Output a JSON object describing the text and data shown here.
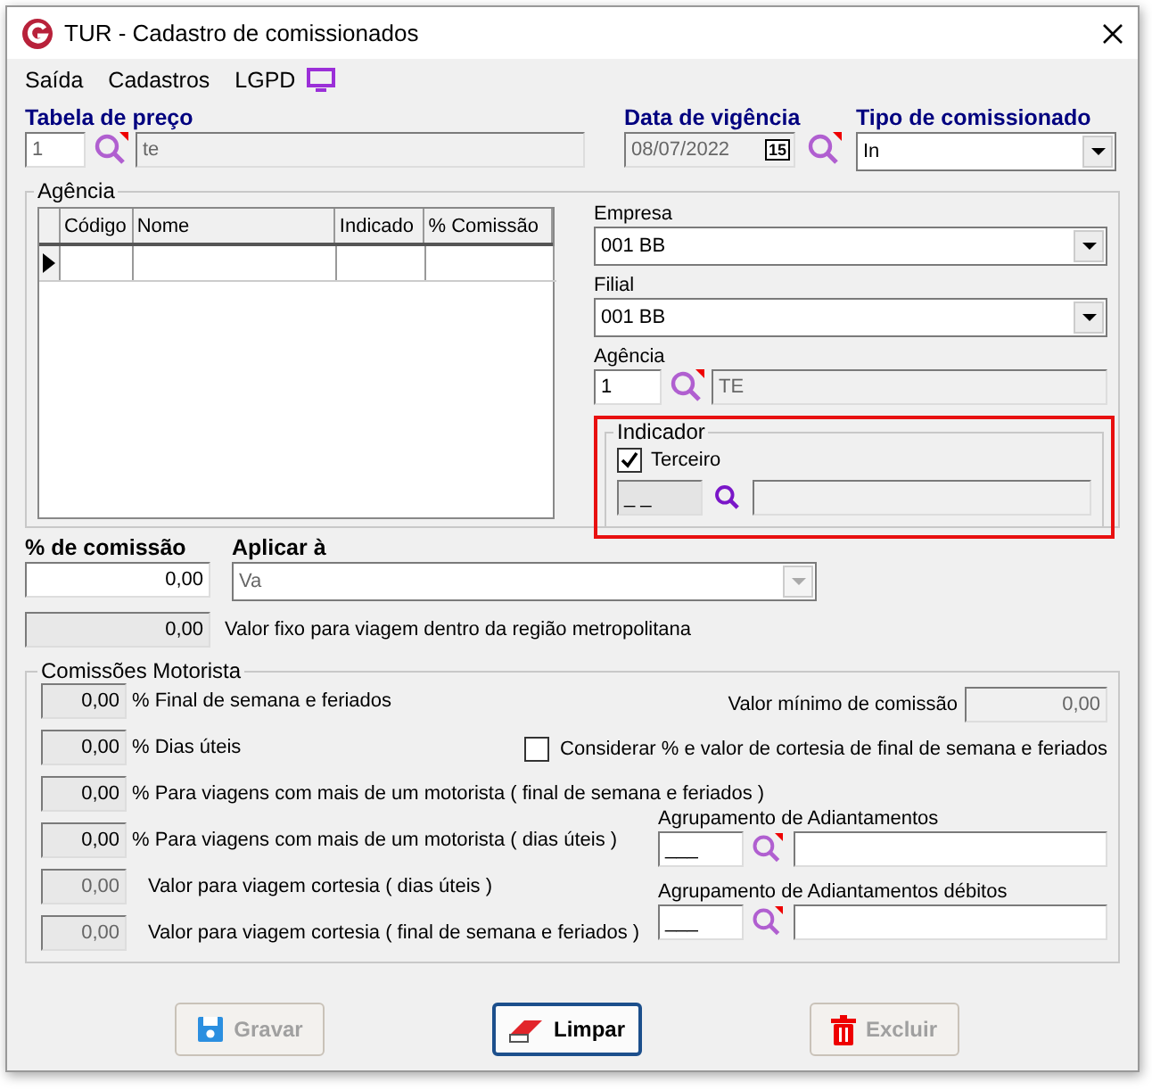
{
  "window": {
    "title": "TUR - Cadastro de comissionados"
  },
  "menu": [
    {
      "label": "Saída"
    },
    {
      "label": "Cadastros"
    },
    {
      "label": "LGPD"
    }
  ],
  "header": {
    "tabela": {
      "label": "Tabela de preço",
      "code": "1",
      "name": "te"
    },
    "data": {
      "label": "Data de vigência",
      "value": "08/07/2022",
      "calendar": "15"
    },
    "tipo": {
      "label": "Tipo de comissionado",
      "value": "In"
    }
  },
  "agencia": {
    "title": "Agência",
    "columns": [
      "Código",
      "Nome",
      "Indicado",
      "% Comissão"
    ],
    "empresa": {
      "label": "Empresa",
      "value": "001 BB"
    },
    "filial": {
      "label": "Filial",
      "value": "001 BB"
    },
    "agencia": {
      "label": "Agência",
      "code": "1",
      "name": "TE"
    },
    "indicador": {
      "title": "Indicador",
      "highlighted": true,
      "terceiro": {
        "label": "Terceiro",
        "checked": true
      },
      "code": "_ _"
    }
  },
  "comissao": {
    "label": "% de comissão",
    "value": "0,00"
  },
  "aplicar": {
    "label": "Aplicar à",
    "value": "Va",
    "disabled": true
  },
  "valor_fixo": {
    "value": "0,00",
    "label": "Valor fixo para viagem dentro da região metropolitana"
  },
  "motorista": {
    "title": "Comissões Motorista",
    "rows": [
      {
        "value": "0,00",
        "label": "% Final de semana e feriados",
        "disabled": false
      },
      {
        "value": "0,00",
        "label": "% Dias úteis",
        "disabled": false
      },
      {
        "value": "0,00",
        "label": "% Para viagens com mais de um motorista ( final de semana e feriados )",
        "disabled": false
      },
      {
        "value": "0,00",
        "label": "% Para viagens com mais de um motorista ( dias úteis )",
        "disabled": false
      },
      {
        "value": "0,00",
        "label": "Valor para viagem cortesia ( dias úteis )",
        "disabled": true
      },
      {
        "value": "0,00",
        "label": "Valor para viagem cortesia ( final de semana e feriados )",
        "disabled": true
      }
    ],
    "valor_minimo": {
      "label": "Valor mínimo de comissão",
      "value": "0,00"
    },
    "considerar": {
      "label": "Considerar % e valor de cortesia de final de semana e feriados",
      "checked": false
    },
    "agrupamentos": [
      {
        "label": "Agrupamento de Adiantamentos",
        "code": "___"
      },
      {
        "label": "Agrupamento de Adiantamentos débitos",
        "code": "___"
      }
    ]
  },
  "buttons": [
    {
      "label": "Gravar",
      "kind": "save",
      "disabled": true,
      "focused": false
    },
    {
      "label": "Limpar",
      "kind": "clear",
      "disabled": false,
      "focused": true
    },
    {
      "label": "Excluir",
      "kind": "delete",
      "disabled": true,
      "focused": false
    }
  ]
}
